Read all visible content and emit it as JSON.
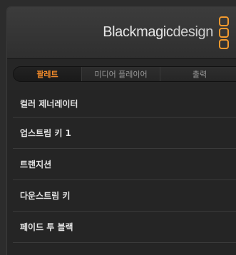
{
  "brand": {
    "name_main": "Blackmagic",
    "name_sub": "design",
    "accent_color": "#f39a2e",
    "logo_icon": "blackmagic-logo-icon"
  },
  "tabs": [
    {
      "label": "팔레트",
      "active": true
    },
    {
      "label": "미디어 플레이어",
      "active": false
    },
    {
      "label": "출력",
      "active": false
    }
  ],
  "palette_items": [
    {
      "label": "컬러 제너레이터"
    },
    {
      "label": "업스트림 키 1"
    },
    {
      "label": "트랜지션"
    },
    {
      "label": "다운스트림 키"
    },
    {
      "label": "페이드 투 블랙"
    }
  ]
}
